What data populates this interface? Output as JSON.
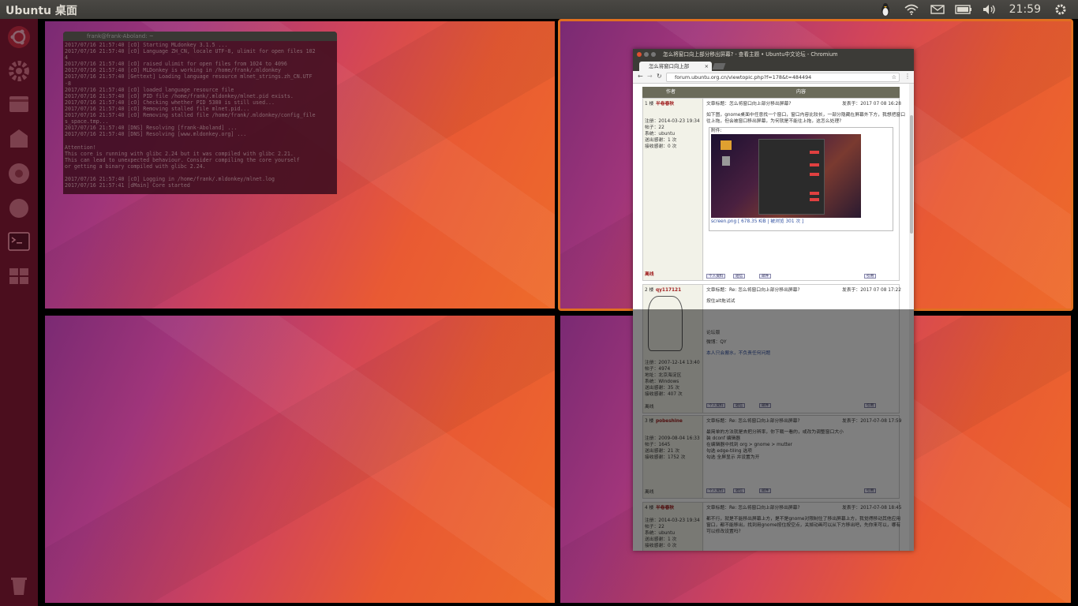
{
  "topbar": {
    "title": "Ubuntu 桌面",
    "clock": "21:59",
    "tray_icons": [
      "tux-icon",
      "wifi-icon",
      "mail-icon",
      "keyboard-icon",
      "volume-icon",
      "gear-icon"
    ]
  },
  "launcher": {
    "items": [
      "ubuntu-dash-icon",
      "settings-icon",
      "files-icon",
      "software-center-icon",
      "chromium-icon",
      "app-icon",
      "terminal-icon",
      "workspaces-icon",
      "trash-icon"
    ]
  },
  "terminal": {
    "title": "frank@frank-Aboland: ~",
    "lines": [
      "2017/07/16 21:57:40 [cO] Starting MLdonkey 3.1.5 ...",
      "2017/07/16 21:57:40 [cO] Language ZH_CN, locale UTF-8, ulimit for open files 102",
      "4",
      "2017/07/16 21:57:40 [cO] raised ulimit for open files from 1024 to 4096",
      "2017/07/16 21:57:40 [cO] MLDonkey is working in /home/frank/.mldonkey",
      "2017/07/16 21:57:40 [Gettext] Loading language resource mlnet_strings.zh_CN.UTF",
      "-8",
      "2017/07/16 21:57:40 [cO] loaded language resource file",
      "2017/07/16 21:57:40 [cO] PID file /home/frank/.mldonkey/mlnet.pid exists.",
      "2017/07/16 21:57:40 [cO] Checking whether PID 5380 is still used...",
      "2017/07/16 21:57:40 [cO] Removing stalled file mlnet.pid...",
      "2017/07/16 21:57:40 [cO] Removing stalled file /home/frank/.mldonkey/config_file",
      "s_space.tmp...",
      "2017/07/16 21:57:40 [DNS] Resolving [frank-Aboland] ...",
      "2017/07/16 21:57:40 [DNS] Resolving [www.mldonkey.org] ...",
      "",
      "Attention!",
      "This core is running with glibc 2.24 but it was compiled with glibc 2.21.",
      "This can lead to unexpected behaviour. Consider compiling the core yourself",
      "or getting a binary compiled with glibc 2.24.",
      "",
      "2017/07/16 21:57:40 [cO] Logging in /home/frank/.mldonkey/mlnet.log",
      "2017/07/16 21:57:41 [dMain] Core started"
    ]
  },
  "chromium": {
    "window_title": "怎么将窗口向上部分移出屏幕? - 查看主题 • Ubuntu中文论坛 - Chromium",
    "tab_label": "怎么将窗口向上部",
    "url": "forum.ubuntu.org.cn/viewtopic.php?f=178&t=484494",
    "forum": {
      "col_author": "作者",
      "col_content": "内容",
      "posts": [
        {
          "floor": "1 楼",
          "author": "半卷春秋",
          "subject": "文章标题：怎么将窗口向上部分移出屏幕?",
          "date": "发表于：2017 07 08 16:28",
          "reg": "注册：2014-03-23 19:34",
          "posts": "帖子：22",
          "system": "系统：ubuntu",
          "thanks_sent": "送出感谢：1 次",
          "thanks_recv": "接收感谢：0 次",
          "body1": "如下图，gnome桌面中任意找一个窗口，窗口内容比较长，一部分隐藏在屏幕外下方，我想把窗口",
          "body2": "往上拖，但会被窗口移出屏幕，为何就是不能往上拖，这怎么处理?",
          "attach_label": "附件:",
          "attach_file": "screen.png [ 678.35 KiB | 被浏览 301 次 ]",
          "status": "离线",
          "btn_profile": "个人资料",
          "btn_pm": "短信",
          "btn_email": "邮件",
          "btn_quote": "引用"
        },
        {
          "floor": "2 楼",
          "author": "qy117121",
          "subject": "文章标题：Re: 怎么将窗口向上部分移出屏幕?",
          "date": "发表于：2017 07 08 17:22",
          "body1": "按住alt拖试试",
          "sig1": "论坛版",
          "sig2": "微博：QY",
          "sig3": "本人只会搬水，不负责任何问题",
          "reg": "注册：2007-12-14 13:40",
          "posts": "帖子：4974",
          "loc": "地址：北京海淀区",
          "system": "系统：Windows",
          "thanks_sent": "送出感谢：35 次",
          "thanks_recv": "接收感谢：407 次",
          "status": "离线",
          "btn_profile": "个人资料",
          "btn_pm": "短信",
          "btn_email": "邮件",
          "btn_quote": "引用"
        },
        {
          "floor": "3 楼",
          "author": "pobeshine",
          "subject": "文章标题：Re: 怎么将窗口向上部分移出屏幕?",
          "date": "发表于：2017-07-08 17:59",
          "body1": "最简单的方法就是去把分辨率，你下载一看的，或改为调整窗口大小",
          "body2": "装 dconf 编辑器",
          "body3": "在编辑器中找到 org > gnome > mutter",
          "body4": "勾选 edge-tiling 选项",
          "body5": "勾选 全屏显示 并设置为开",
          "reg": "注册：2009-08-04 16:33",
          "posts": "帖子：1645",
          "thanks_sent": "送出感谢：21 次",
          "thanks_recv": "接收感谢：1752 次",
          "status": "离线",
          "btn_profile": "个人资料",
          "btn_pm": "短信",
          "btn_email": "邮件",
          "btn_quote": "引用"
        },
        {
          "floor": "4 楼",
          "author": "半卷春秋",
          "subject": "文章标题：Re: 怎么将窗口向上部分移出屏幕?",
          "date": "发表于：2017-07-08 18:45",
          "body1": "都不行，就是不能移出屏幕上方，是不是gnome对限制住了移出屏幕上方，我觉得移动其他应用",
          "body2": "窗口，都不能移出，找到用gnome按住按空点，关掉动画可以从下方移出吧，先你来可以，哪有",
          "body3": "可以修改设置吗?",
          "reg": "注册：2014-03-23 19:34",
          "posts": "帖子：22",
          "system": "系统：ubuntu",
          "thanks_sent": "送出感谢：1 次",
          "thanks_recv": "接收感谢：0 次"
        }
      ]
    }
  },
  "colors": {
    "panel": "#3c3b37",
    "launcher": "#4b0e1e",
    "active_border": "#e07020",
    "wallpaper_start": "#7a2a73",
    "wallpaper_end": "#ee6b2a"
  }
}
